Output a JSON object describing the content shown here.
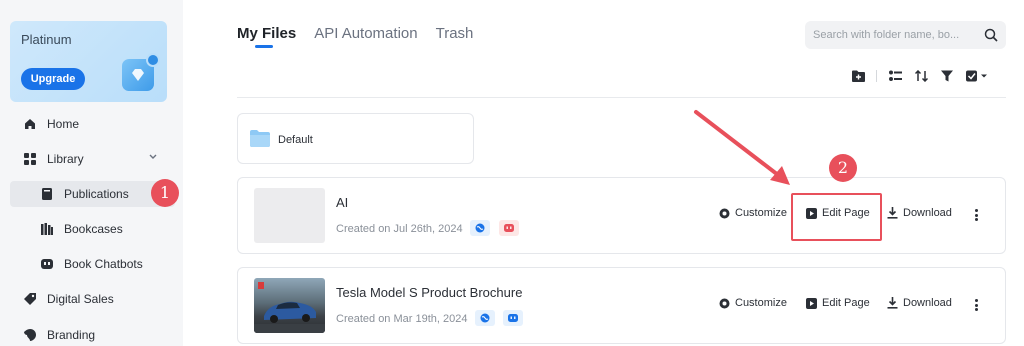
{
  "sidebar": {
    "plan": {
      "name": "Platinum",
      "upgrade_label": "Upgrade"
    },
    "items": [
      {
        "label": "Home",
        "icon": "home-icon"
      },
      {
        "label": "Library",
        "icon": "grid-icon"
      },
      {
        "label": "Publications",
        "icon": "book-icon"
      },
      {
        "label": "Bookcases",
        "icon": "bookcase-icon"
      },
      {
        "label": "Book Chatbots",
        "icon": "chatbot-icon"
      },
      {
        "label": "Digital Sales",
        "icon": "tag-icon"
      },
      {
        "label": "Branding",
        "icon": "branding-icon"
      }
    ]
  },
  "tabs": [
    {
      "label": "My Files"
    },
    {
      "label": "API Automation"
    },
    {
      "label": "Trash"
    }
  ],
  "search": {
    "placeholder": "Search with folder name, bo..."
  },
  "folder": {
    "label": "Default"
  },
  "files": [
    {
      "title": "AI",
      "created": "Created on Jul 26th, 2024",
      "actions": {
        "customize": "Customize",
        "edit": "Edit Page",
        "download": "Download"
      }
    },
    {
      "title": "Tesla Model S Product Brochure",
      "created": "Created on Mar 19th, 2024",
      "actions": {
        "customize": "Customize",
        "edit": "Edit Page",
        "download": "Download"
      }
    }
  ],
  "annotations": {
    "step1": "1",
    "step2": "2"
  },
  "colors": {
    "accent": "#1a73e8",
    "annotation": "#e8505b"
  }
}
